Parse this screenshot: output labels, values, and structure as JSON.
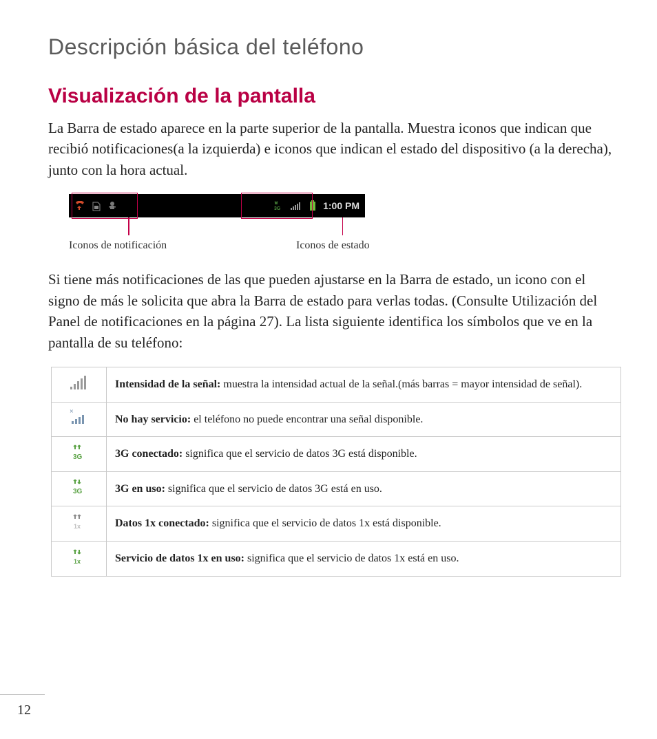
{
  "page_number": "12",
  "section_title": "Descripción básica del teléfono",
  "subtitle": "Visualización de la pantalla",
  "paragraph1": "La Barra de estado aparece en la parte superior de la pantalla. Muestra iconos que indican que recibió notificaciones(a la izquierda) e iconos que indican el estado del dispositivo (a la derecha), junto con la hora actual.",
  "statusbar": {
    "time": "1:00 PM",
    "caption_left": "Iconos de notificación",
    "caption_right": "Iconos de estado"
  },
  "paragraph2": "Si tiene más notificaciones de las que pueden ajustarse en la Barra de estado, un icono con el signo de más le solicita que abra la Barra de estado para verlas todas. (Consulte Utilización del Panel de notificaciones en la página 27). La lista siguiente identifica los símbolos que ve en la pantalla de su teléfono:",
  "rows": [
    {
      "icon": "signal",
      "term": "Intensidad de la señal:",
      "desc": " muestra la intensidad actual de la señal.(más barras = mayor intensidad de señal)."
    },
    {
      "icon": "nosignal",
      "term": "No hay servicio:",
      "desc": " el teléfono no puede encontrar una señal disponible."
    },
    {
      "icon": "3g-avail",
      "term": "3G conectado:",
      "desc": " significa que el servicio de datos 3G está disponible."
    },
    {
      "icon": "3g-use",
      "term": "3G en uso:",
      "desc": " significa que el servicio de datos 3G está en uso."
    },
    {
      "icon": "1x-avail",
      "term": "Datos 1x conectado:",
      "desc": " significa que el servicio de datos 1x está disponible."
    },
    {
      "icon": "1x-use",
      "term": "Servicio de datos 1x en uso:",
      "desc": " significa que el servicio de datos 1x está en uso."
    }
  ]
}
